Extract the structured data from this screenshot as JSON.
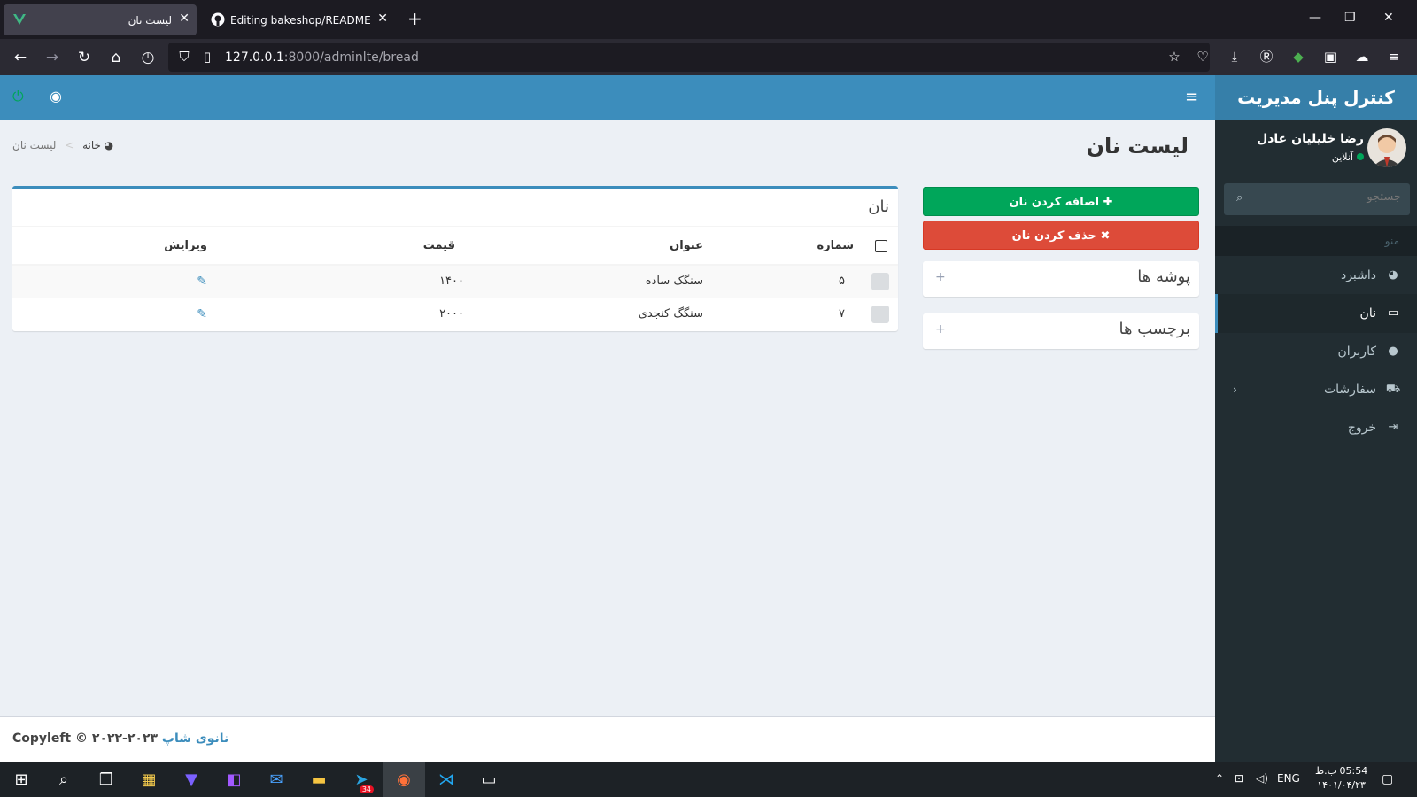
{
  "browser": {
    "tabs": [
      {
        "title": "لیست نان",
        "active": true
      },
      {
        "title": "Editing bakeshop/README.md",
        "active": false
      }
    ],
    "url_host": "127.0.0.1",
    "url_rest": ":8000/adminlte/bread"
  },
  "app": {
    "logo": "کنترل پنل مدیریت",
    "user": {
      "name": "رضا خلیلیان عادل",
      "status": "آنلاین"
    },
    "search_placeholder": "جستجو",
    "menu_header": "منو",
    "menu": [
      {
        "label": "داشبرد",
        "icon": "dashboard-icon"
      },
      {
        "label": "نان",
        "icon": "laptop-icon",
        "active": true
      },
      {
        "label": "کاربران",
        "icon": "user-icon"
      },
      {
        "label": "سفارشات",
        "icon": "cart-icon",
        "has_children": true
      },
      {
        "label": "خروج",
        "icon": "sign-out-icon"
      }
    ],
    "page_title": "لیست نان",
    "breadcrumb": {
      "home": "خانه",
      "current": "لیست نان"
    },
    "buttons": {
      "add": "اضافه کردن نان",
      "delete": "حذف کردن نان"
    },
    "widgets": [
      {
        "title": "پوشه ها"
      },
      {
        "title": "برچسب ها"
      }
    ],
    "box_title": "نان",
    "table": {
      "headers": [
        "",
        "شماره",
        "عنوان",
        "قیمت",
        "ویرایش"
      ],
      "rows": [
        {
          "id": "۵",
          "title": "سنگک ساده",
          "price": "۱۴۰۰"
        },
        {
          "id": "۷",
          "title": "سنگگ کنجدی",
          "price": "۲۰۰۰"
        }
      ]
    },
    "footer": {
      "copyright": "Copyleft © ۲۰۲۲-۲۰۲۳",
      "link": "نانوی شاپ"
    }
  },
  "taskbar": {
    "lang": "ENG",
    "time": "05:54 ب.ظ",
    "date": "۱۴۰۱/۰۴/۲۳",
    "telegram_badge": "34"
  },
  "colors": {
    "primary": "#3c8dbc",
    "success": "#00a65a",
    "danger": "#dd4b39",
    "sidebar": "#222d32"
  }
}
